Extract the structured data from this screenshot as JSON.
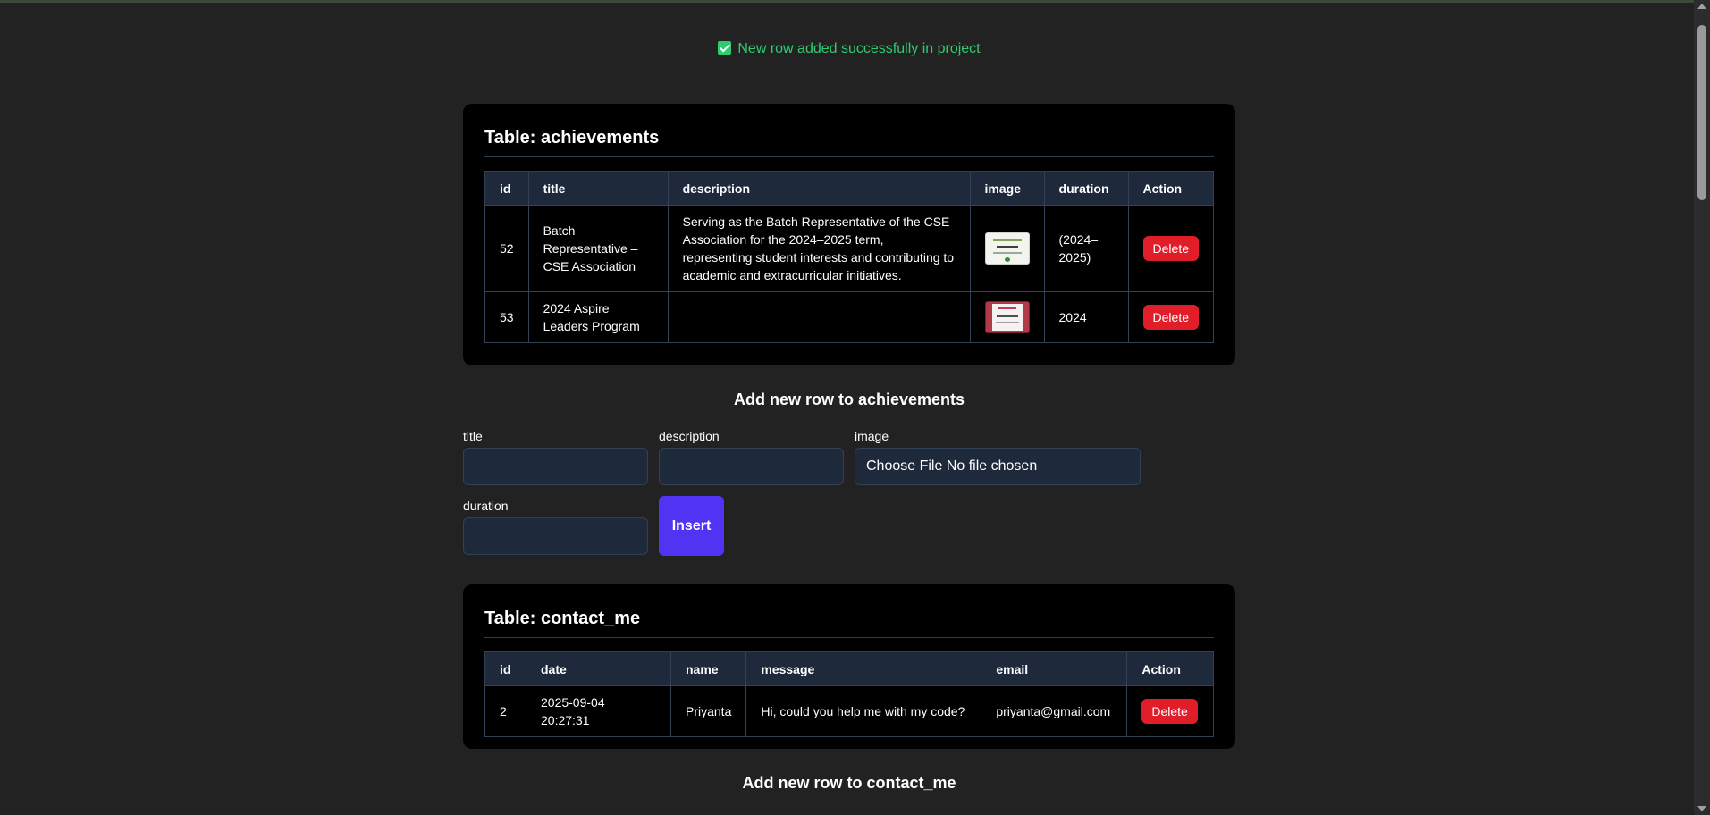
{
  "success_message": "New row added successfully in project",
  "achievements": {
    "table_title": "Table: achievements",
    "columns": [
      "id",
      "title",
      "description",
      "image",
      "duration",
      "Action"
    ],
    "rows": [
      {
        "id": "52",
        "title": "Batch Representative – CSE Association",
        "description": "Serving as the Batch Representative of the CSE Association for the 2024–2025 term, representing student interests and contributing to academic and extracurricular initiatives.",
        "image": "certificate-thumbnail-green",
        "duration": "(2024–2025)",
        "action": "Delete"
      },
      {
        "id": "53",
        "title": "2024 Aspire Leaders Program",
        "description": "",
        "image": "certificate-thumbnail-red",
        "duration": "2024",
        "action": "Delete"
      }
    ],
    "form": {
      "heading": "Add new row to achievements",
      "title_label": "title",
      "description_label": "description",
      "image_label": "image",
      "file_input_text": "Choose File No file chosen",
      "duration_label": "duration",
      "insert_label": "Insert"
    }
  },
  "contact_me": {
    "table_title": "Table: contact_me",
    "columns": [
      "id",
      "date",
      "name",
      "message",
      "email",
      "Action"
    ],
    "rows": [
      {
        "id": "2",
        "date": "2025-09-04 20:27:31",
        "name": "Priyanta",
        "message": "Hi, could you help me with my code?",
        "email": "priyanta@gmail.com",
        "action": "Delete"
      }
    ],
    "form": {
      "heading": "Add new row to contact_me"
    }
  },
  "colors": {
    "background": "#222222",
    "success": "#2ecc71",
    "delete": "#e11d2a",
    "insert": "#4f35f3",
    "header_cell": "#1e293b"
  }
}
